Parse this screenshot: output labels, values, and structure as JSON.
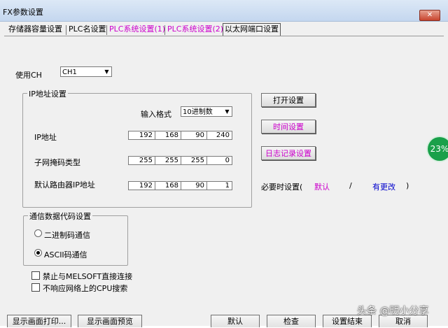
{
  "window": {
    "title": "FX参数设置",
    "close_label": "✕"
  },
  "tabs": [
    "存储器容量设置",
    "PLC名设置",
    "PLC系统设置(1)",
    "PLC系统设置(2)",
    "以太网端口设置"
  ],
  "colors": {
    "tab_accent": "#cc00cc",
    "link_blue": "#0000cc",
    "badge_green": "#1aa04a"
  },
  "channel": {
    "label": "使用CH",
    "value": "CH1"
  },
  "ip_group": {
    "title": "IP地址设置",
    "format_label": "输入格式",
    "format_value": "10进制数",
    "ip_label": "IP地址",
    "ip": [
      "192",
      "168",
      "90",
      "240"
    ],
    "subnet_label": "子网掩码类型",
    "subnet": [
      "255",
      "255",
      "255",
      "0"
    ],
    "gateway_label": "默认路由器IP地址",
    "gateway": [
      "192",
      "168",
      "90",
      "1"
    ]
  },
  "side_buttons": {
    "open": "打开设置",
    "time": "时间设置",
    "log": "日志记录设置"
  },
  "required": {
    "label": "必要时设置(",
    "default": "默认",
    "slash": "/",
    "changed": "有更改",
    "close_paren": ")"
  },
  "code_group": {
    "title": "通信数据代码设置",
    "binary": "二进制码通信",
    "ascii": "ASCII码通信"
  },
  "checkboxes": {
    "forbid_melsoft": "禁止与MELSOFT直接连接",
    "no_cpu_search": "不响应网络上的CPU搜索"
  },
  "bottom": {
    "print": "显示画面打印...",
    "preview": "显示画面预览",
    "default": "默认",
    "check": "检查",
    "finish": "设置结束",
    "cancel": "取消"
  },
  "badge": "23%",
  "watermark": "头条 @明小分享"
}
